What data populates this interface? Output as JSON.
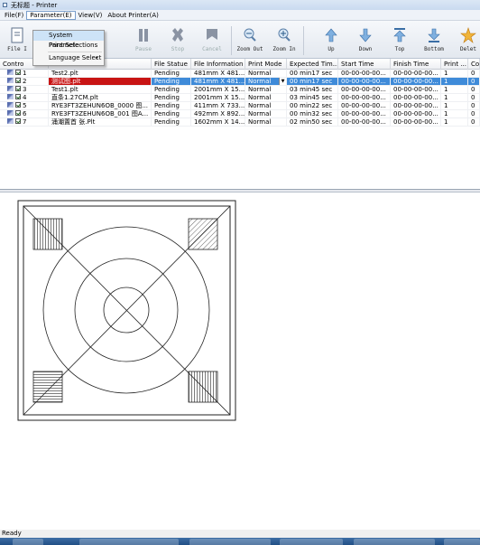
{
  "window": {
    "title": "无标题 - Printer"
  },
  "menu": {
    "items": [
      "File(F)",
      "Parameter(E)",
      "View(V)",
      "About Printer(A)"
    ],
    "open_index": 1,
    "dropdown": {
      "items": [
        "System Paramete",
        "Print Selections",
        "Language Select"
      ],
      "highlighted_index": 0,
      "submenu_arrow": "▸"
    }
  },
  "toolbar": {
    "buttons": [
      {
        "label": "File I",
        "icon": "file-icon",
        "enabled": true
      },
      {
        "label": "Pause",
        "icon": "pause-icon",
        "enabled": false
      },
      {
        "label": "Stop",
        "icon": "stop-icon",
        "enabled": false
      },
      {
        "label": "Cancel",
        "icon": "cancel-icon",
        "enabled": false
      },
      {
        "label": "Zoom Out",
        "icon": "zoom-out-icon",
        "enabled": true
      },
      {
        "label": "Zoom In",
        "icon": "zoom-in-icon",
        "enabled": true
      },
      {
        "label": "Up",
        "icon": "up-icon",
        "enabled": true
      },
      {
        "label": "Down",
        "icon": "down-icon",
        "enabled": true
      },
      {
        "label": "Top",
        "icon": "top-icon",
        "enabled": true
      },
      {
        "label": "Bottom",
        "icon": "bottom-icon",
        "enabled": true
      },
      {
        "label": "Delet",
        "icon": "delete-icon",
        "enabled": true
      }
    ]
  },
  "table": {
    "columns": [
      "Contro",
      "",
      "File Statue",
      "File Information",
      "Print Mode",
      "Expected Tim...",
      "Start Time",
      "Finish Time",
      "Print ...",
      "Co"
    ],
    "rows": [
      {
        "no": "1",
        "file": "Test2.plt",
        "status": "Pending",
        "info": "481mm X 481...",
        "mode": "Normal",
        "expected": "00 min17 sec",
        "start": "00-00-00-00...",
        "finish": "00-00-00-00...",
        "print": "1",
        "co": "0"
      },
      {
        "no": "2",
        "file": "测试图.plt",
        "status": "Pending",
        "info": "481mm X 481...",
        "mode": "Normal",
        "expected": "00 min17 sec",
        "start": "00-00-00-00...",
        "finish": "00-00-00-00...",
        "print": "1",
        "co": "0"
      },
      {
        "no": "3",
        "file": "Test1.plt",
        "status": "Pending",
        "info": "2001mm X 15...",
        "mode": "Normal",
        "expected": "03 min45 sec",
        "start": "00-00-00-00...",
        "finish": "00-00-00-00...",
        "print": "1",
        "co": "0"
      },
      {
        "no": "4",
        "file": "直条1.27CM.plt",
        "status": "Pending",
        "info": "2001mm X 15...",
        "mode": "Normal",
        "expected": "03 min45 sec",
        "start": "00-00-00-00...",
        "finish": "00-00-00-00...",
        "print": "1",
        "co": "0"
      },
      {
        "no": "5",
        "file": "RYE3FT3ZEHUN6OB_0000 图...",
        "status": "Pending",
        "info": "411mm X 733...",
        "mode": "Normal",
        "expected": "00 min22 sec",
        "start": "00-00-00-00...",
        "finish": "00-00-00-00...",
        "print": "1",
        "co": "0"
      },
      {
        "no": "6",
        "file": "RYE3FT3ZEHUN6OB_001 图A...",
        "status": "Pending",
        "info": "492mm X 892...",
        "mode": "Normal",
        "expected": "00 min32 sec",
        "start": "00-00-00-00...",
        "finish": "00-00-00-00...",
        "print": "1",
        "co": "0"
      },
      {
        "no": "7",
        "file": "涌潮置首 张.Plt",
        "status": "Pending",
        "info": "1602mm X 14...",
        "mode": "Normal",
        "expected": "02 min50 sec",
        "start": "00-00-00-00...",
        "finish": "00-00-00-00...",
        "print": "1",
        "co": "0"
      }
    ],
    "selected_row": 1
  },
  "status": {
    "text": "Ready"
  },
  "colors": {
    "selection_blue": "#3f8bd9",
    "selection_red": "#c81414",
    "drawing_line": "#222222"
  }
}
